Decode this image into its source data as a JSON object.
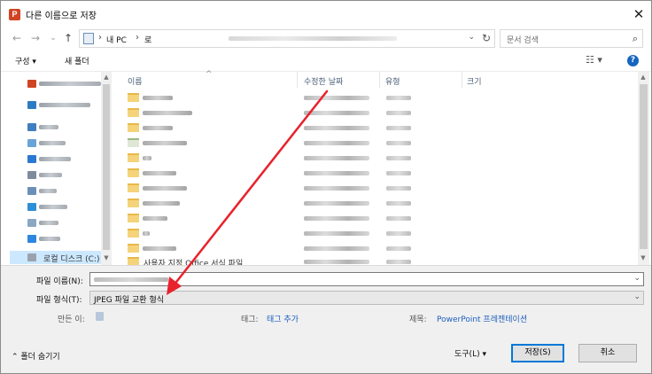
{
  "window": {
    "title": "다른 이름으로 저장",
    "app_icon": "P",
    "close_label": "✕"
  },
  "nav": {
    "back_icon": "←",
    "forward_icon": "→",
    "recent_icon": "⌄",
    "up_icon": "↑",
    "address": {
      "segments": [
        "내 PC",
        "로"
      ],
      "separator": "›",
      "dropdown_icon": "⌄",
      "refresh_icon": "↻"
    },
    "search": {
      "placeholder": "문서 검색",
      "icon": "⌕"
    }
  },
  "toolbar": {
    "organize_label": "구성 ▾",
    "new_folder_label": "새 폴더",
    "view_icon": "☷ ▾",
    "help_label": "?"
  },
  "sidebar": {
    "selected_label": "로컬 디스크 (C:)"
  },
  "filelist": {
    "columns": [
      "이름",
      "수정한 날짜",
      "유형",
      "크기"
    ],
    "sort_caret": "^",
    "last_row_text": "사용자 지정 Office 서식 파일"
  },
  "form": {
    "filename_label": "파일 이름(N):",
    "filetype_label": "파일 형식(T):",
    "filetype_value": "JPEG 파일 교환 형식",
    "dropdown_icon": "⌄",
    "authors_label": "만든 이:",
    "tags_label": "태그:",
    "tags_value": "태그 추가",
    "title_label": "제목:",
    "title_value": "PowerPoint 프레젠테이션"
  },
  "footer": {
    "hide_folders_label": "⌃ 폴더 숨기기",
    "tools_label": "도구(L) ▾",
    "save_label": "저장(S)",
    "cancel_label": "취소"
  },
  "colors": {
    "accent": "#0078d7",
    "selection": "#cce8ff",
    "annotation_arrow": "#e8222c",
    "app_icon": "#d04423"
  }
}
